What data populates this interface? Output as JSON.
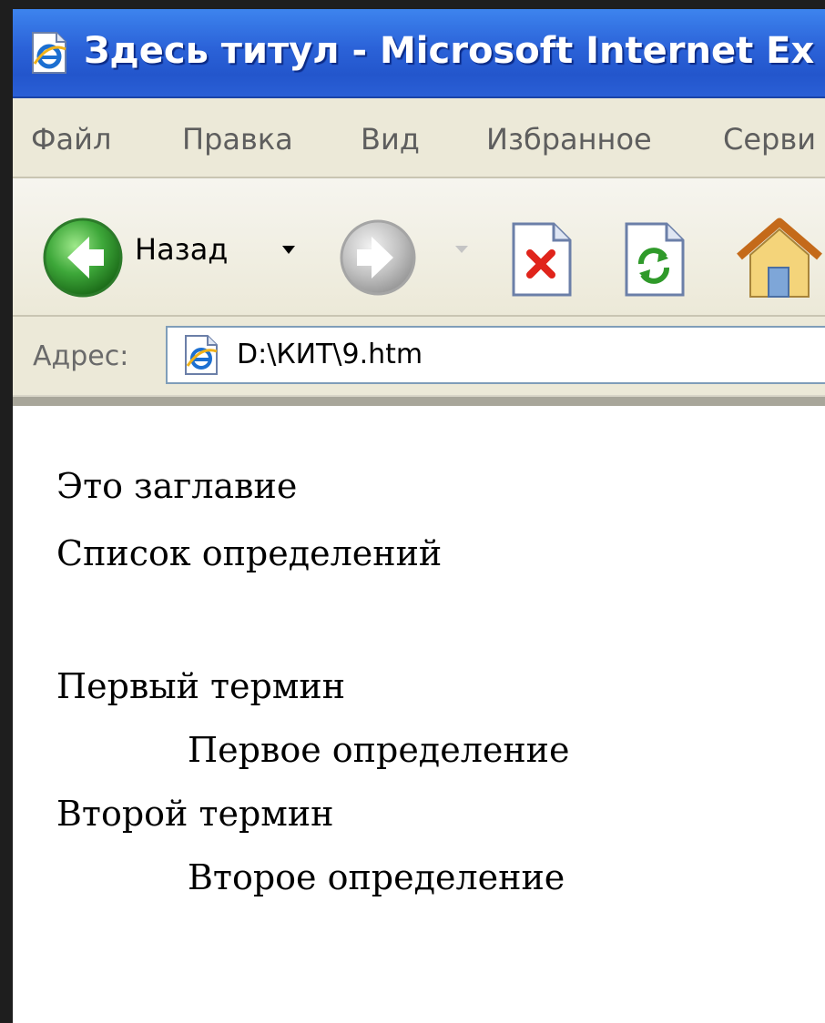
{
  "window": {
    "title": "Здесь титул - Microsoft Internet Ex",
    "title_icon": "ie-page-icon"
  },
  "menu": {
    "items": [
      "Файл",
      "Правка",
      "Вид",
      "Избранное",
      "Серви"
    ]
  },
  "toolbar": {
    "back_label": "Назад",
    "icons": [
      "back-arrow-icon",
      "forward-arrow-icon",
      "stop-icon",
      "refresh-icon",
      "home-icon"
    ]
  },
  "address": {
    "label": "Адрес:",
    "value": "D:\\КИТ\\9.htm"
  },
  "content": {
    "heading": "Это заглавие",
    "list_title": "Список определений",
    "terms": [
      {
        "term": "Первый термин",
        "definition": "Первое определение"
      },
      {
        "term": "Второй термин",
        "definition": "Второе определение"
      }
    ]
  },
  "colors": {
    "titlebar": "#2b62d8",
    "chrome": "#ece9d8",
    "back_button_green": "#3ea83a",
    "forward_button_gray": "#b9b9b9"
  }
}
